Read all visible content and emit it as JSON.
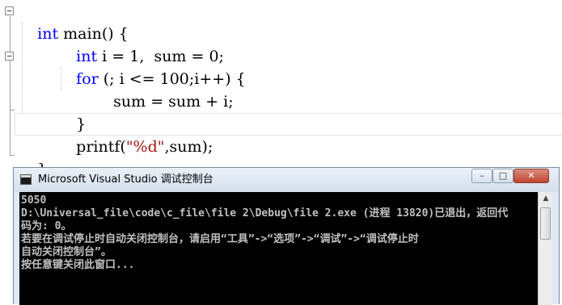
{
  "editor": {
    "lines": [
      {
        "kw": "int",
        "rest": " main() {"
      },
      {
        "kw": "int",
        "rest": " i = 1,  sum = 0;"
      },
      {
        "kw": "for",
        "rest": " (; i <= 100;i++) {"
      },
      {
        "text": "sum = sum + i;"
      },
      {
        "text": "}"
      },
      {
        "pre": "printf(",
        "str": "\"%d\"",
        "post": ",sum);"
      },
      {
        "text": "}"
      }
    ],
    "fold_symbol": "−"
  },
  "console": {
    "title": "Microsoft Visual Studio 调试控制台",
    "buttons": {
      "minimize": "–",
      "maximize": "□",
      "close": "✕"
    },
    "output": [
      "5050",
      "D:\\Universal_file\\code\\c_file\\file 2\\Debug\\file 2.exe (进程 13820)已退出，返回代",
      "码为: 0。",
      "若要在调试停止时自动关闭控制台，请启用“工具”->“选项”->“调试”->“调试停止时",
      "自动关闭控制台”。",
      "按任意键关闭此窗口..."
    ],
    "scroll_up_glyph": "▲"
  },
  "colors": {
    "keyword": "#0000ff",
    "string": "#a31515",
    "console_bg": "#000000",
    "console_text": "#c0c0c0"
  }
}
